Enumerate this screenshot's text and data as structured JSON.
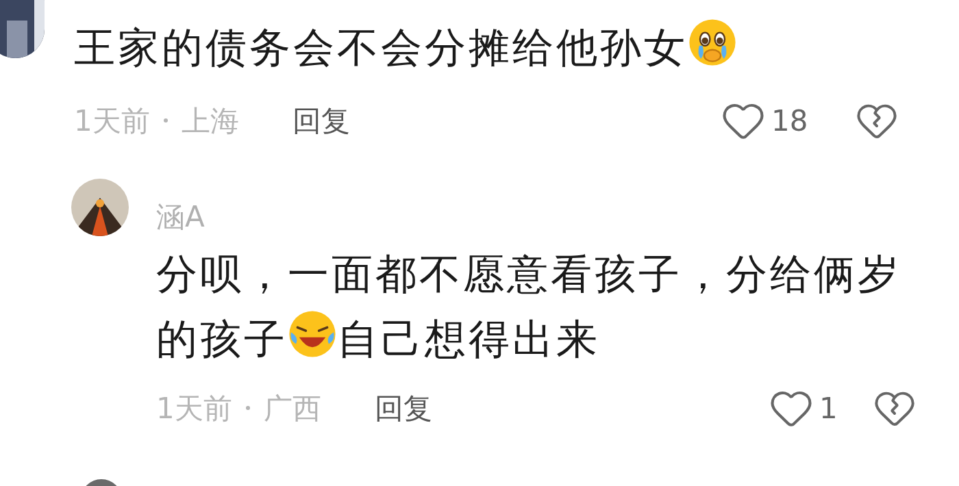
{
  "comment": {
    "body": [
      {
        "kind": "text",
        "text": "王家的债务会不会分摊给他孙女"
      },
      {
        "kind": "sob"
      }
    ],
    "time": "1天前",
    "location": "上海",
    "reply": "回复",
    "likes": "18"
  },
  "reply": {
    "author": "涵A",
    "body": [
      {
        "kind": "text",
        "text": "分呗，一面都不愿意看孩子，分给俩岁的孩子"
      },
      {
        "kind": "laugh"
      },
      {
        "kind": "text",
        "text": "自己想得出来"
      }
    ],
    "time": "1天前",
    "location": "广西",
    "reply": "回复",
    "likes": "1"
  }
}
